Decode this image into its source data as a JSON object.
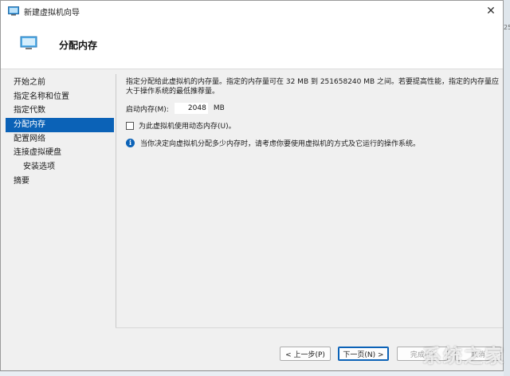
{
  "window": {
    "title": "新建虚拟机向导",
    "close_glyph": "✕"
  },
  "header": {
    "title": "分配内存"
  },
  "nav": {
    "items": [
      {
        "label": "开始之前",
        "selected": false,
        "sub": false
      },
      {
        "label": "指定名称和位置",
        "selected": false,
        "sub": false
      },
      {
        "label": "指定代数",
        "selected": false,
        "sub": false
      },
      {
        "label": "分配内存",
        "selected": true,
        "sub": false
      },
      {
        "label": "配置网络",
        "selected": false,
        "sub": false
      },
      {
        "label": "连接虚拟硬盘",
        "selected": false,
        "sub": false
      },
      {
        "label": "安装选项",
        "selected": false,
        "sub": true
      },
      {
        "label": "摘要",
        "selected": false,
        "sub": false
      }
    ]
  },
  "content": {
    "description": "指定分配给此虚拟机的内存量。指定的内存量可在 32 MB 到 251658240 MB 之间。若要提高性能，指定的内存量应大于操作系统的最低推荐量。",
    "startup_memory_label": "启动内存(M):",
    "startup_memory_value": "2048",
    "memory_unit": "MB",
    "dynamic_memory_label": "为此虚拟机使用动态内存(U)。",
    "dynamic_memory_checked": false,
    "info_text": "当你决定向虚拟机分配多少内存时，请考虑你要使用虚拟机的方式及它运行的操作系统。"
  },
  "buttons": {
    "prev": "< 上一步(P)",
    "next": "下一页(N) >",
    "finish": "完成(F)",
    "cancel": "取消"
  },
  "watermark": "系统之家",
  "edge_text": "25",
  "colors": {
    "accent": "#0b62b7",
    "window_bg": "#f0f0f0"
  }
}
